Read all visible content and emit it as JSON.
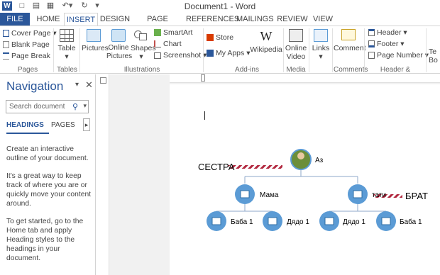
{
  "window": {
    "title": "Document1 - Word"
  },
  "tabs": [
    "FILE",
    "HOME",
    "INSERT",
    "DESIGN",
    "PAGE LAYOUT",
    "REFERENCES",
    "MAILINGS",
    "REVIEW",
    "VIEW"
  ],
  "ribbon": {
    "pages": {
      "items": [
        "Cover Page",
        "Blank Page",
        "Page Break"
      ],
      "group": "Pages"
    },
    "tables": {
      "button": "Table",
      "group": "Tables"
    },
    "illustrations": {
      "pictures": "Pictures",
      "online_pictures": "Online Pictures",
      "shapes": "Shapes",
      "smartart": "SmartArt",
      "chart": "Chart",
      "screenshot": "Screenshot",
      "group": "Illustrations"
    },
    "addins": {
      "store": "Store",
      "my_apps": "My Apps",
      "wikipedia": "Wikipedia",
      "group": "Add-ins"
    },
    "media": {
      "online_video": "Online Video",
      "group": "Media"
    },
    "links": {
      "button": "Links"
    },
    "comments": {
      "button": "Comment",
      "group": "Comments"
    },
    "header_footer": {
      "items": [
        "Header",
        "Footer",
        "Page Number"
      ],
      "group": "Header & Footer"
    },
    "text": {
      "cut": "Te Bo"
    }
  },
  "navigation": {
    "title": "Navigation",
    "search_placeholder": "Search document",
    "tabs": [
      "HEADINGS",
      "PAGES"
    ],
    "desc": [
      "Create an interactive outline of your document.",
      "It's a great way to keep track of where you are or quickly move your content around.",
      "To get started, go to the Home tab and apply Heading styles to the headings in your document."
    ]
  },
  "diagram": {
    "root": "Аз",
    "level1": [
      "Мама",
      "тати"
    ],
    "level2": [
      "Баба 1",
      "Дядо 1",
      "Дядо 1",
      "Баба 1"
    ],
    "left_note": "СЕСТРА",
    "right_note": "БРАТ"
  },
  "colors": {
    "accent": "#2b579a",
    "node_blue": "#5b9bd5",
    "note_red": "#b2283f"
  }
}
